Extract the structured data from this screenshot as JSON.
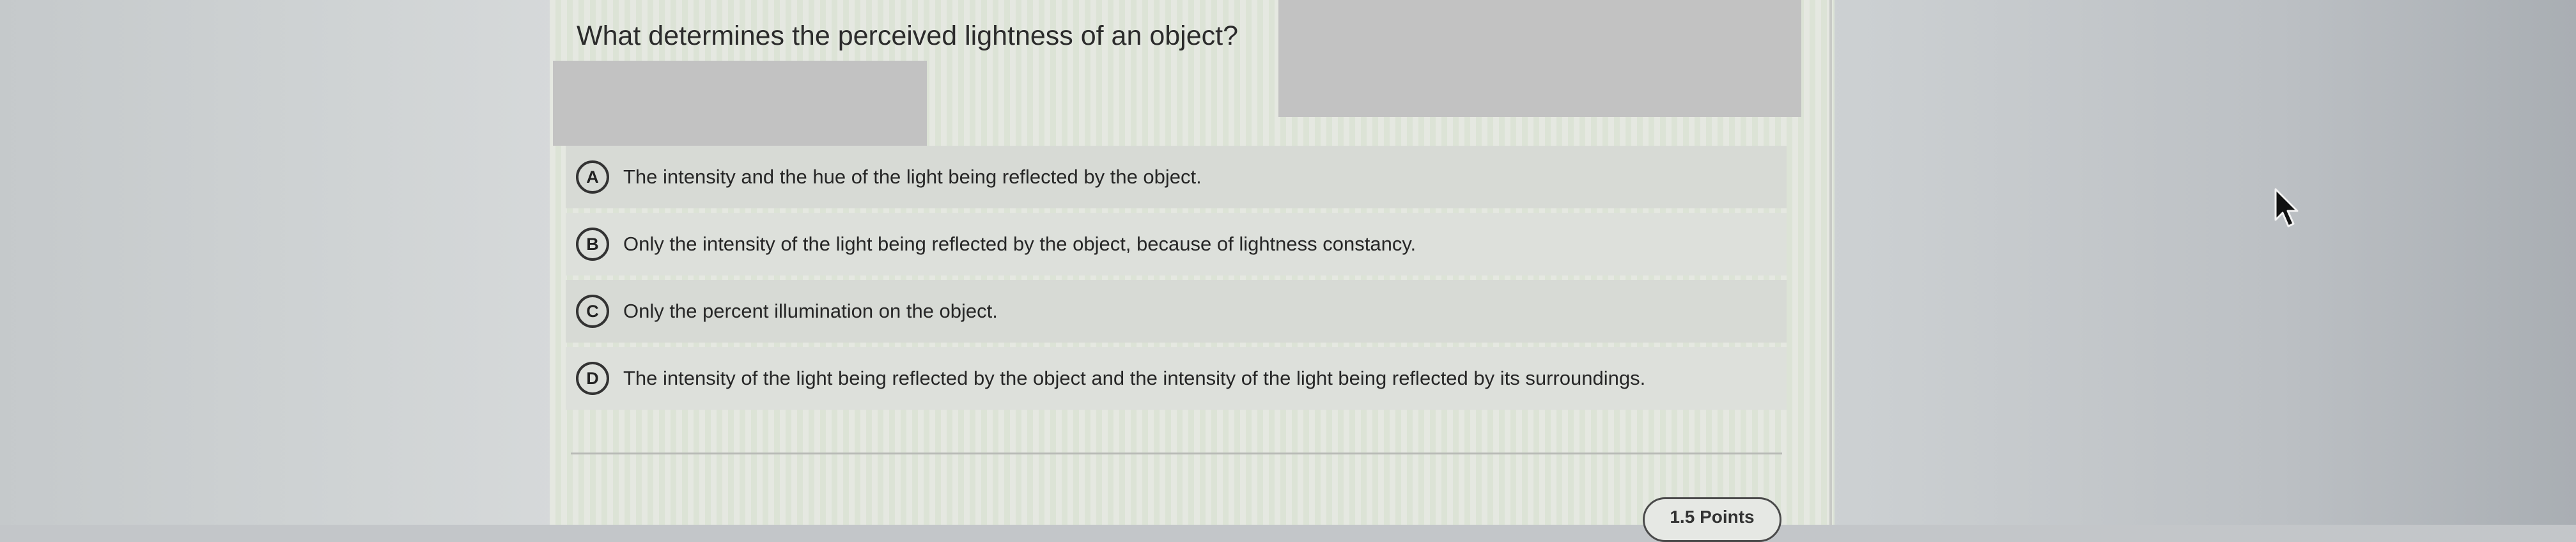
{
  "question": {
    "text": "What determines the perceived lightness of an object?"
  },
  "options": [
    {
      "letter": "A",
      "text": "The intensity and the hue of the light being reflected by the object."
    },
    {
      "letter": "B",
      "text": "Only the intensity of the light being reflected by the object, because of lightness constancy."
    },
    {
      "letter": "C",
      "text": "Only the percent illumination on the object."
    },
    {
      "letter": "D",
      "text": "The intensity of the light being reflected by the object and the intensity of the light being reflected by its surroundings."
    }
  ],
  "footer": {
    "points": "1.5 Points"
  },
  "icons": {
    "cursor": "mouse-pointer-icon"
  }
}
